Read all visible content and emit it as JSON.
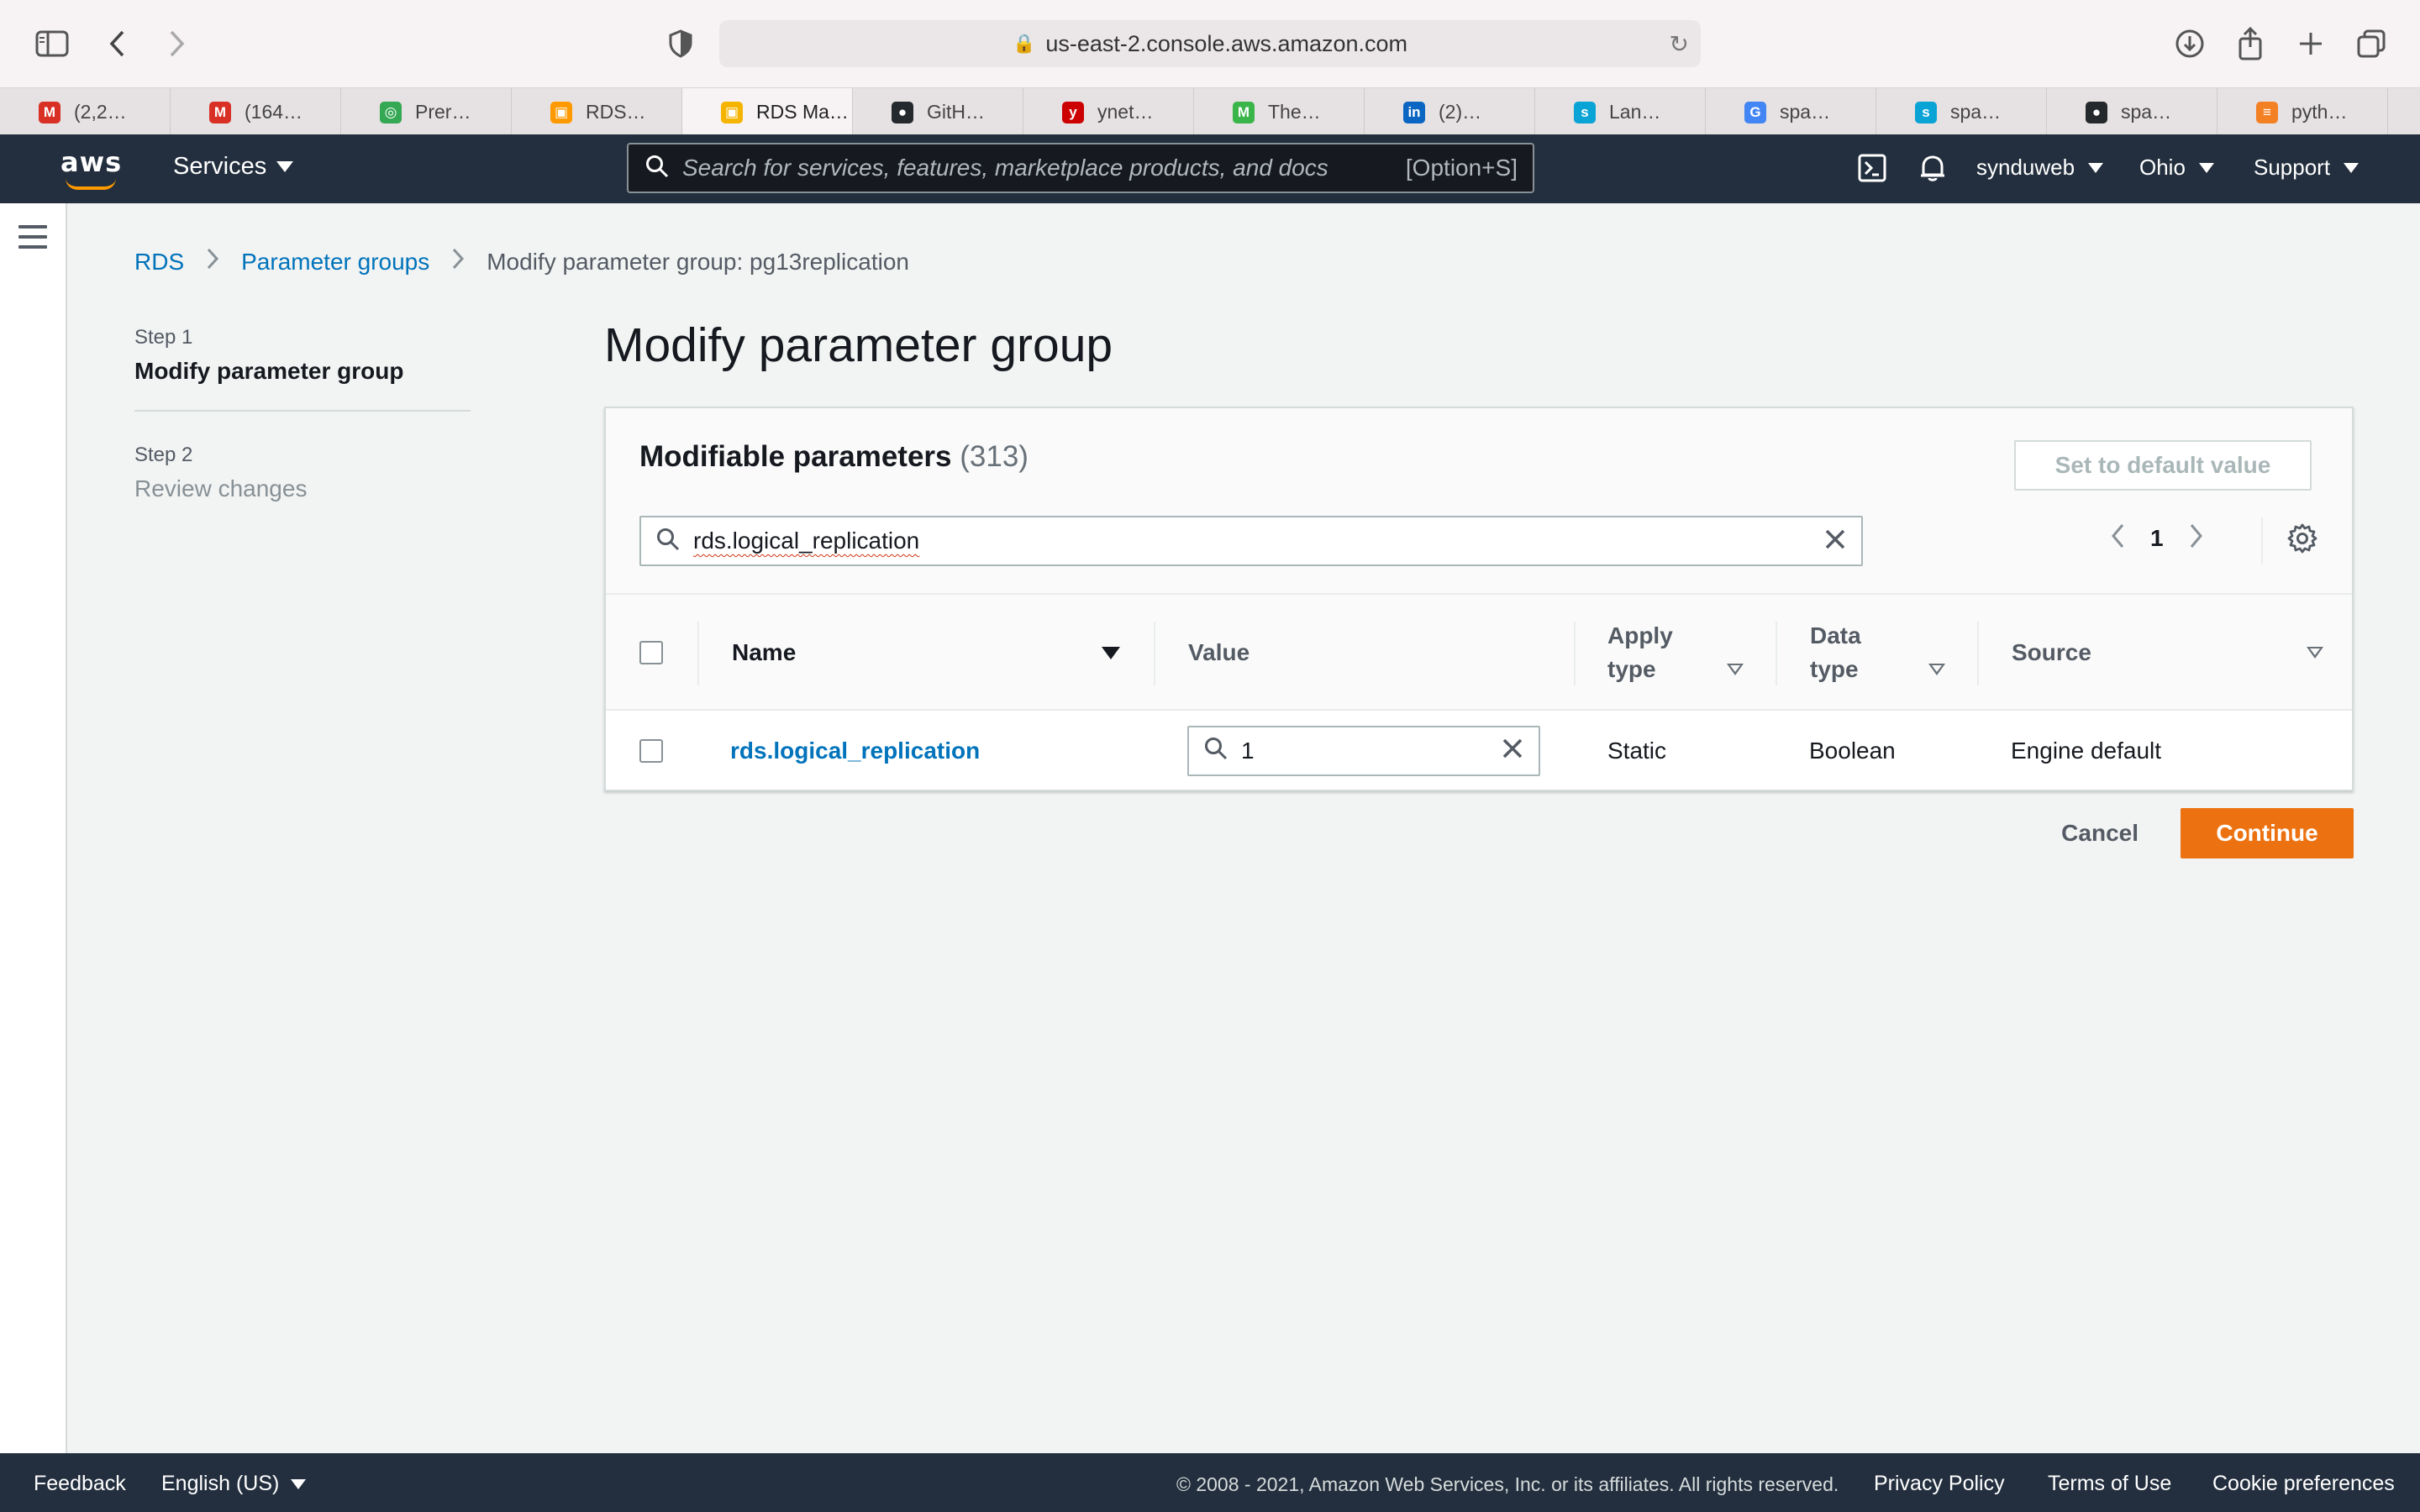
{
  "browser": {
    "url": "us-east-2.console.aws.amazon.com",
    "tabs": [
      {
        "label": "(2,2…",
        "icon": "gmail-icon",
        "color": "#d93025",
        "glyph": "M"
      },
      {
        "label": "(164…",
        "icon": "gmail-icon",
        "color": "#d93025",
        "glyph": "M"
      },
      {
        "label": "Prer…",
        "icon": "chrome-icon",
        "color": "#34a853",
        "glyph": "◎"
      },
      {
        "label": "RDS…",
        "icon": "aws-rds-icon",
        "color": "#ff9900",
        "glyph": "▣"
      },
      {
        "label": "RDS Ma…",
        "icon": "aws-rds-icon",
        "color": "#f5b400",
        "glyph": "▣"
      },
      {
        "label": "GitH…",
        "icon": "github-icon",
        "color": "#24292e",
        "glyph": "●"
      },
      {
        "label": "ynet…",
        "icon": "ynet-icon",
        "color": "#cc0000",
        "glyph": "y"
      },
      {
        "label": "The…",
        "icon": "medium-icon",
        "color": "#3ab54a",
        "glyph": "M"
      },
      {
        "label": "(2)…",
        "icon": "linkedin-icon",
        "color": "#0a66c2",
        "glyph": "in"
      },
      {
        "label": "Lan…",
        "icon": "spacy-icon",
        "color": "#09a3d5",
        "glyph": "s"
      },
      {
        "label": "spa…",
        "icon": "google-icon",
        "color": "#4285f4",
        "glyph": "G"
      },
      {
        "label": "spa…",
        "icon": "spacy-icon",
        "color": "#09a3d5",
        "glyph": "s"
      },
      {
        "label": "spa…",
        "icon": "github-icon",
        "color": "#24292e",
        "glyph": "●"
      },
      {
        "label": "pyth…",
        "icon": "stackoverflow-icon",
        "color": "#f48024",
        "glyph": "≡"
      }
    ],
    "active_tab_index": 4
  },
  "nav": {
    "services_label": "Services",
    "search_placeholder": "Search for services, features, marketplace products, and docs",
    "search_shortcut": "[Option+S]",
    "account": "synduweb",
    "region": "Ohio",
    "support": "Support"
  },
  "breadcrumb": {
    "rds": "RDS",
    "parameter_groups": "Parameter groups",
    "current": "Modify parameter group: pg13replication"
  },
  "steps": {
    "step1_label": "Step 1",
    "step1_title": "Modify parameter group",
    "step2_label": "Step 2",
    "step2_title": "Review changes"
  },
  "page_title": "Modify parameter group",
  "panel": {
    "title": "Modifiable parameters",
    "count": "(313)",
    "set_default_label": "Set to default value",
    "filter_value": "rds.logical_replication",
    "page_number": "1"
  },
  "table": {
    "headers": {
      "name": "Name",
      "value": "Value",
      "apply_type_1": "Apply",
      "apply_type_2": "type",
      "data_type_1": "Data",
      "data_type_2": "type",
      "source": "Source"
    },
    "rows": [
      {
        "name": "rds.logical_replication",
        "value": "1",
        "apply_type": "Static",
        "data_type": "Boolean",
        "source": "Engine default"
      }
    ]
  },
  "actions": {
    "cancel": "Cancel",
    "continue": "Continue"
  },
  "footer": {
    "feedback": "Feedback",
    "language": "English (US)",
    "copyright": "© 2008 - 2021, Amazon Web Services, Inc. or its affiliates. All rights reserved.",
    "privacy": "Privacy Policy",
    "terms": "Terms of Use",
    "cookies": "Cookie preferences"
  },
  "colors": {
    "aws_nav": "#232f3e",
    "link": "#0073bb",
    "primary_button": "#ec7211",
    "aws_orange": "#ff9900"
  }
}
